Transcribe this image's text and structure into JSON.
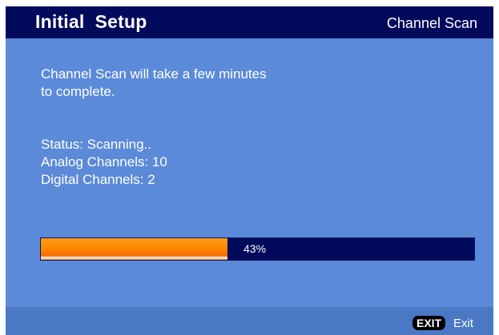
{
  "header": {
    "title": "Initial  Setup",
    "section": "Channel Scan"
  },
  "message": {
    "line1": "Channel Scan will take a few minutes",
    "line2": "to complete."
  },
  "status": {
    "status_text": "Status: Scanning..",
    "analog_text": "Analog Channels: 10",
    "digital_text": "Digital Channels: 2"
  },
  "progress": {
    "percent": 43,
    "label": "43%"
  },
  "footer": {
    "exit_key": "EXIT",
    "exit_label": "Exit"
  },
  "colors": {
    "background": "#5b8ad8",
    "header_bar": "#020a5c",
    "progress_fill": "#ff8a00",
    "progress_track": "#020a5c"
  }
}
